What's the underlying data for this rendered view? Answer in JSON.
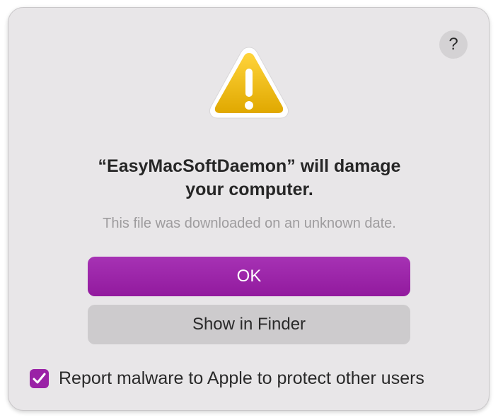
{
  "dialog": {
    "help_label": "?",
    "icon": "warning-triangle-icon",
    "title_line1": "“EasyMacSoftDaemon” will damage",
    "title_line2": "your computer.",
    "subtitle": "This file was downloaded on an unknown date.",
    "ok_label": "OK",
    "finder_label": "Show in Finder",
    "report_label": "Report malware to Apple to protect other users",
    "report_checked": true
  },
  "colors": {
    "accent": "#9a22a6",
    "dialog_bg": "#e8e6e8",
    "secondary_button": "#cdcbcd",
    "warning_yellow": "#f2c200"
  }
}
